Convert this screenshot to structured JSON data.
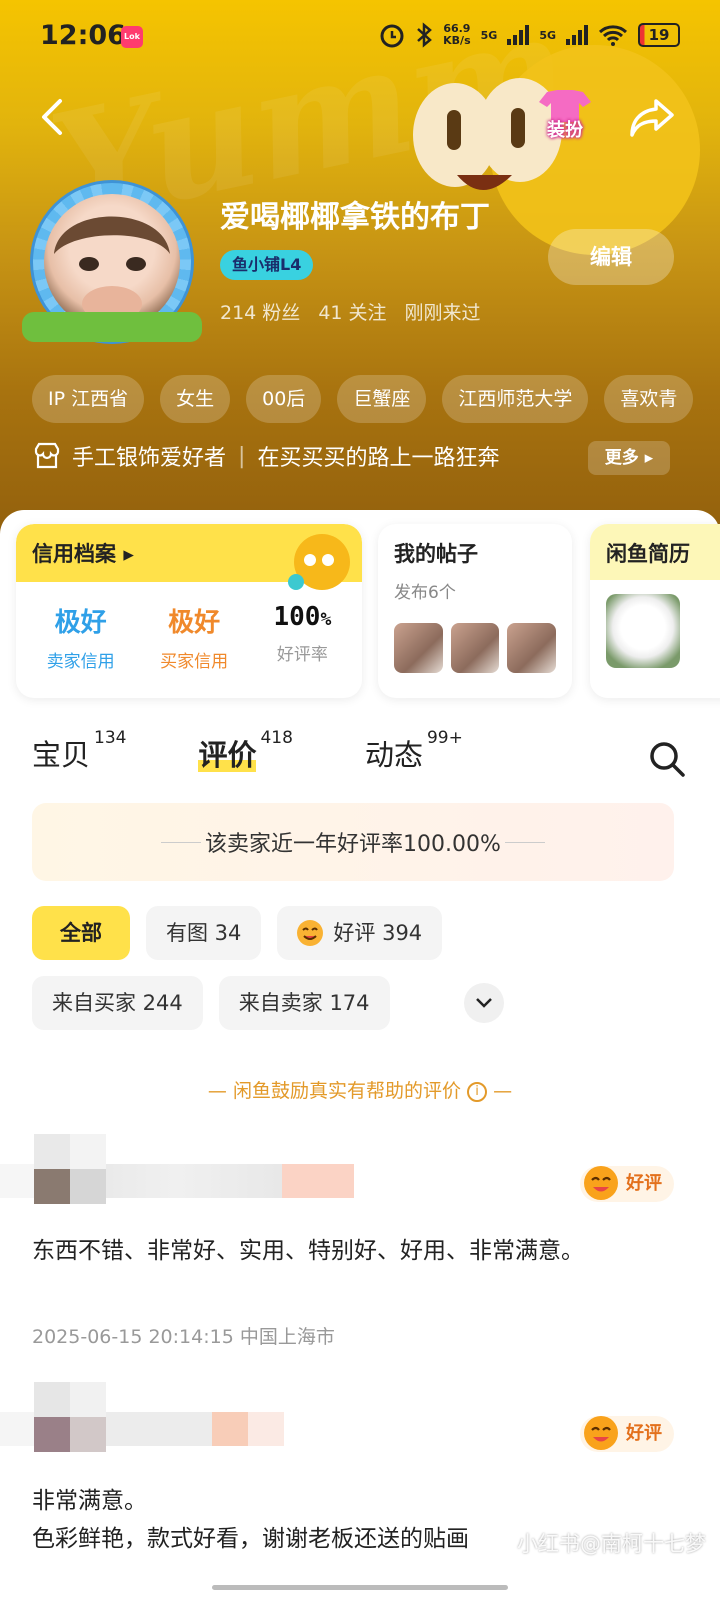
{
  "status_bar": {
    "time": "12:06",
    "app_icon_text": "Lok",
    "net_speed_value": "66.9",
    "net_speed_unit": "KB/s",
    "signal1": "5G",
    "signal2": "5G",
    "battery": "19"
  },
  "header": {
    "watermark": "Yumm",
    "dress_up_label": "装扮",
    "nickname": "爱喝椰椰拿铁的布丁",
    "level_badge": "鱼小铺L4",
    "fans": "214 粉丝",
    "follows": "41 关注",
    "last_seen": "刚刚来过",
    "edit_label": "编辑",
    "tags": [
      "IP 江西省",
      "女生",
      "00后",
      "巨蟹座",
      "江西师范大学",
      "喜欢青"
    ],
    "bio_part1": "手工银饰爱好者",
    "bio_part2": "在买买买的路上一路狂奔",
    "more_label": "更多"
  },
  "cards": {
    "credit_title": "信用档案",
    "credit_items": [
      {
        "value": "极好",
        "label": "卖家信用",
        "color": "#2fa0e8"
      },
      {
        "value": "极好",
        "label": "买家信用",
        "color": "#f0892b"
      },
      {
        "value": "100",
        "unit": "%",
        "label": "好评率",
        "color": "#111111"
      }
    ],
    "posts_title": "我的帖子",
    "posts_sub": "发布6个",
    "resume_title": "闲鱼简历"
  },
  "tabs": [
    {
      "label": "宝贝",
      "count": "134"
    },
    {
      "label": "评价",
      "count": "418"
    },
    {
      "label": "动态",
      "count": "99+"
    }
  ],
  "banner": "该卖家近一年好评率100.00%",
  "filters": {
    "row1": [
      "全部",
      "有图 34",
      "好评 394"
    ],
    "row2": [
      "来自买家 244",
      "来自卖家 174"
    ]
  },
  "encourage_text": "— 闲鱼鼓励真实有帮助的评价",
  "reviews": [
    {
      "badge": "好评",
      "text": "东西不错、非常好、实用、特别好、好用、非常满意。",
      "meta": "2025-06-15 20:14:15 中国上海市"
    },
    {
      "badge": "好评",
      "text_line1": "非常满意。",
      "text_line2": "色彩鲜艳，款式好看，谢谢老板还送的贴画"
    }
  ],
  "corner_watermark": "小红书@南柯十七梦",
  "colors": {
    "accent_yellow": "#ffe14a",
    "header_top": "#f5c400",
    "header_bottom": "#8f5d0c",
    "good_review": "#e3701c",
    "encourage": "#e39a2a"
  }
}
